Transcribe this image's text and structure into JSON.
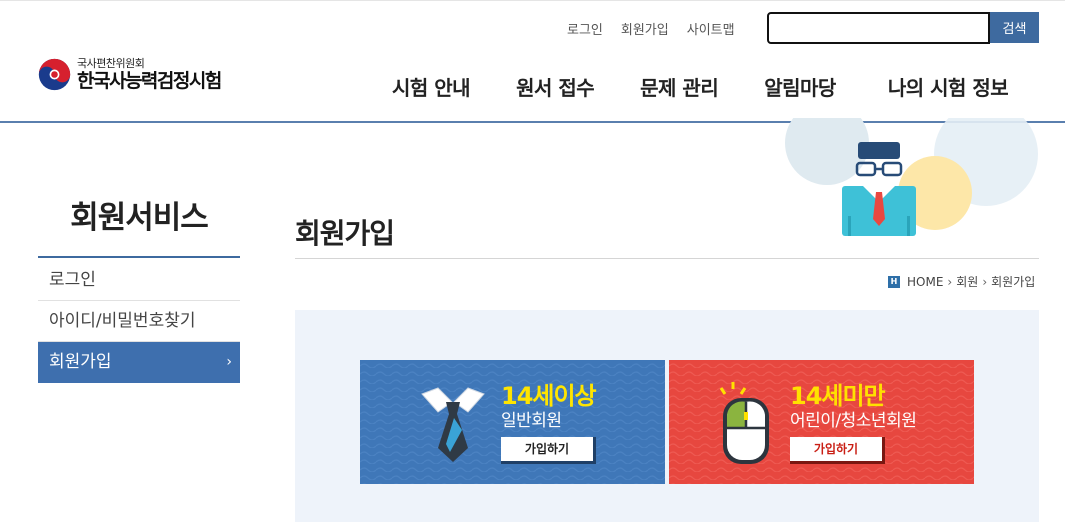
{
  "util_links": [
    "로그인",
    "회원가입",
    "사이트맵"
  ],
  "search": {
    "placeholder": "",
    "button": "검색"
  },
  "logo": {
    "sub": "국사편찬위원회",
    "main": "한국사능력검정시험"
  },
  "gnb": [
    "시험 안내",
    "원서 접수",
    "문제 관리",
    "알림마당",
    "나의 시험 정보"
  ],
  "sidebar": {
    "title": "회원서비스",
    "items": [
      {
        "label": "로그인",
        "active": false
      },
      {
        "label": "아이디/비밀번호찾기",
        "active": false
      },
      {
        "label": "회원가입",
        "active": true,
        "chevron": "›"
      }
    ]
  },
  "content": {
    "title": "회원가입",
    "breadcrumb": {
      "badge": "H",
      "items": [
        "HOME",
        "회원",
        "회원가입"
      ],
      "sep": "›"
    }
  },
  "cards": [
    {
      "age": "14세이상",
      "type": "일반회원",
      "button": "가입하기",
      "icon": "necktie-icon",
      "color": "#3f77b8"
    },
    {
      "age": "14세미만",
      "type": "어린이/청소년회원",
      "button": "가입하기",
      "icon": "mouse-icon",
      "color": "#e7473f"
    }
  ],
  "colors": {
    "accent": "#3e6fae",
    "rule": "#5a7fae",
    "highlight": "#ffe500"
  }
}
